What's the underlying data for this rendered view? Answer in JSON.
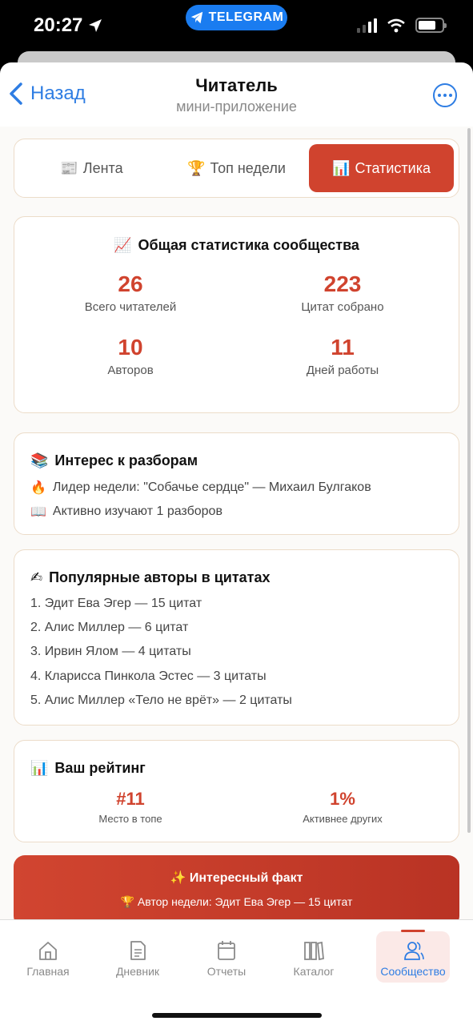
{
  "status": {
    "time": "20:27",
    "telegram": "TELEGRAM"
  },
  "header": {
    "back_label": "Назад",
    "title": "Читатель",
    "subtitle": "мини-приложение"
  },
  "tabs": [
    {
      "icon": "📰",
      "label": "Лента"
    },
    {
      "icon": "🏆",
      "label": "Топ недели"
    },
    {
      "icon": "📊",
      "label": "Статистика"
    }
  ],
  "stats": {
    "icon": "📈",
    "title": "Общая статистика сообщества",
    "items": [
      {
        "value": "26",
        "label": "Всего читателей"
      },
      {
        "value": "223",
        "label": "Цитат собрано"
      },
      {
        "value": "10",
        "label": "Авторов"
      },
      {
        "value": "11",
        "label": "Дней работы"
      }
    ]
  },
  "interest": {
    "icon": "📚",
    "title": "Интерес к разборам",
    "lines": [
      {
        "icon": "🔥",
        "text": "Лидер недели: \"Собачье сердце\" — Михаил Булгаков"
      },
      {
        "icon": "📖",
        "text": "Активно изучают 1 разборов"
      }
    ]
  },
  "authors": {
    "icon": "✍",
    "title": "Популярные авторы в цитатах",
    "items": [
      "1. Эдит Ева Эгер — 15 цитат",
      "2. Алис Миллер — 6 цитат",
      "3. Ирвин Ялом — 4 цитаты",
      "4. Кларисса Пинкола Эстес — 3 цитаты",
      "5. Алис Миллер «Тело не врёт» — 2 цитаты"
    ]
  },
  "rating": {
    "icon": "📊",
    "title": "Ваш рейтинг",
    "items": [
      {
        "value": "#11",
        "label": "Место в топе"
      },
      {
        "value": "1%",
        "label": "Активнее других"
      }
    ]
  },
  "fact": {
    "icon": "✨",
    "title": "Интересный факт",
    "text_icon": "🏆",
    "text": "Автор недели: Эдит Ева Эгер — 15 цитат"
  },
  "nav": [
    {
      "icon": "home-icon",
      "label": "Главная"
    },
    {
      "icon": "diary-icon",
      "label": "Дневник"
    },
    {
      "icon": "calendar-icon",
      "label": "Отчеты"
    },
    {
      "icon": "books-icon",
      "label": "Каталог"
    },
    {
      "icon": "community-icon",
      "label": "Сообщество"
    }
  ],
  "colors": {
    "accent": "#d0432e",
    "link": "#2e7de3",
    "telegram": "#1a7cf0"
  }
}
